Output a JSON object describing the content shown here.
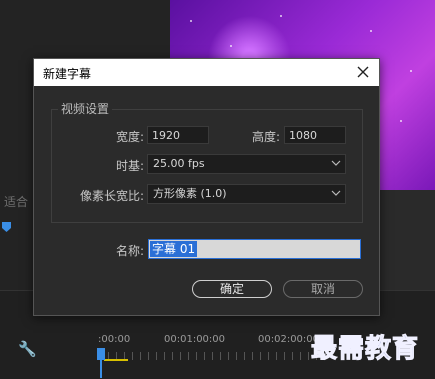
{
  "dialog": {
    "title": "新建字幕",
    "group_title": "视频设置",
    "width_label": "宽度:",
    "width_value": "1920",
    "height_label": "高度:",
    "height_value": "1080",
    "timebase_label": "时基:",
    "timebase_value": "25.00 fps",
    "aspect_label": "像素长宽比:",
    "aspect_value": "方形像素 (1.0)",
    "name_label": "名称:",
    "name_value": "字幕 01",
    "ok_label": "确定",
    "cancel_label": "取消"
  },
  "background": {
    "fit_label": "适合",
    "timecodes": [
      ":00:00",
      "00:01:00:00",
      "00:02:00:00"
    ]
  },
  "watermark": "最需教育",
  "colors": {
    "accent": "#2a6fd6",
    "playhead": "#3a8ee6",
    "preview": "#9a2ad6"
  }
}
